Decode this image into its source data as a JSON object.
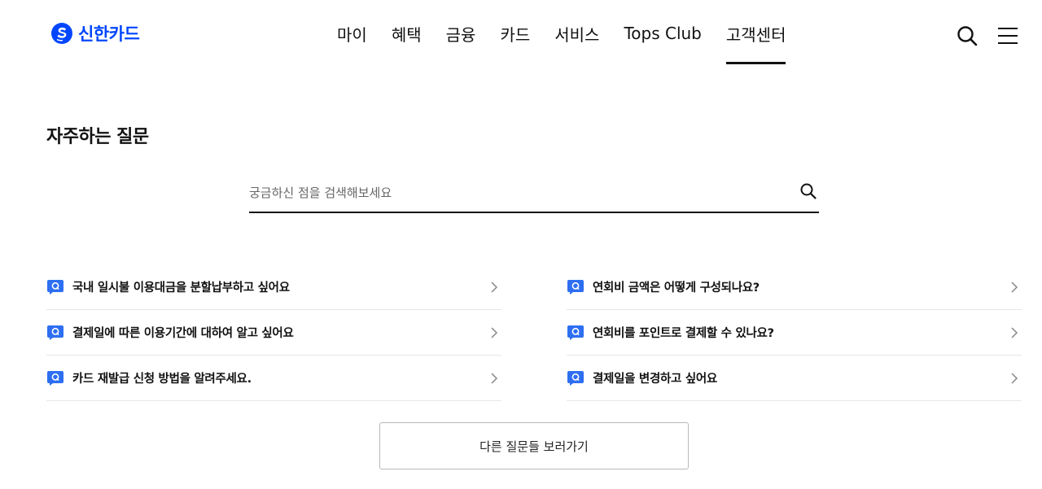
{
  "brand": {
    "name": "신한카드",
    "color": "#0046ff",
    "logo_icon": "shinhan-s-logo-icon"
  },
  "nav": {
    "items": [
      {
        "label": "마이",
        "active": false
      },
      {
        "label": "혜택",
        "active": false
      },
      {
        "label": "금융",
        "active": false
      },
      {
        "label": "카드",
        "active": false
      },
      {
        "label": "서비스",
        "active": false
      },
      {
        "label": "Tops Club",
        "active": false
      },
      {
        "label": "고객센터",
        "active": true
      }
    ],
    "search_icon": "search-icon",
    "menu_icon": "hamburger-menu-icon"
  },
  "page": {
    "title": "자주하는 질문"
  },
  "search": {
    "placeholder": "궁금하신 점을 검색해보세요",
    "value": "",
    "icon": "search-icon"
  },
  "faq": {
    "badge_icon": "q-chat-bubble-icon",
    "badge_color": "#2e6ff2",
    "left": [
      {
        "text": "국내 일시불 이용대금을 분할납부하고 싶어요"
      },
      {
        "text": "결제일에 따른 이용기간에 대하여 알고 싶어요"
      },
      {
        "text": "카드 재발급 신청 방법을 알려주세요."
      }
    ],
    "right": [
      {
        "text": "연회비 금액은 어떻게 구성되나요?"
      },
      {
        "text": "연회비를 포인트로 결제할 수 있나요?"
      },
      {
        "text": "결제일을 변경하고 싶어요"
      }
    ]
  },
  "more_button": {
    "label": "다른 질문들 보러가기"
  }
}
